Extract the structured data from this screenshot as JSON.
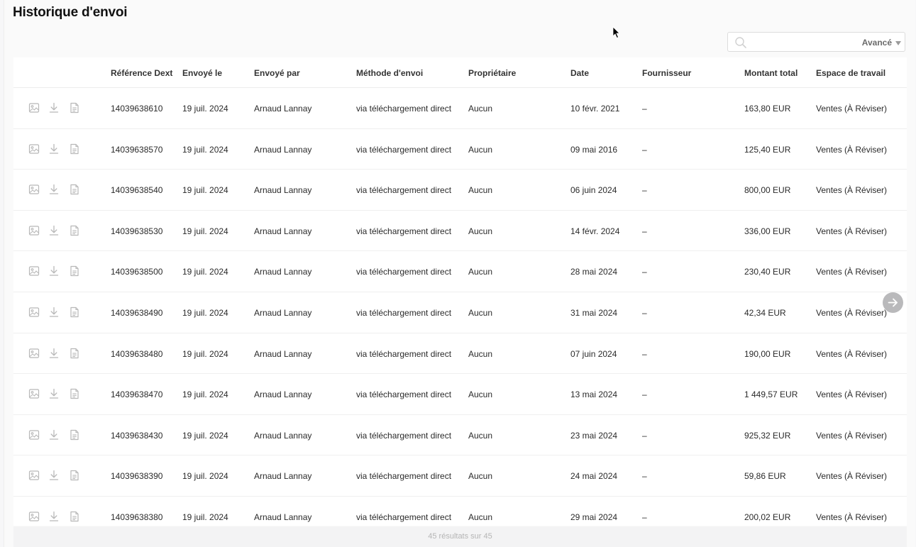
{
  "page": {
    "title": "Historique d'envoi",
    "footer_text": "45 résultats sur 45"
  },
  "search": {
    "placeholder": "",
    "value": "",
    "advanced_label": "Avancé"
  },
  "icons": {
    "row_actions": [
      "image-preview-icon",
      "download-icon",
      "document-icon"
    ],
    "next_page": "arrow-right-icon",
    "search": "search-icon"
  },
  "colors": {
    "icon_gray": "#b8b8b8",
    "header_text": "#333333",
    "next_button": "#b9b9bb"
  },
  "table": {
    "columns": [
      {
        "key": "ref",
        "label": "Référence Dext"
      },
      {
        "key": "sent_on",
        "label": "Envoyé le"
      },
      {
        "key": "sent_by",
        "label": "Envoyé par"
      },
      {
        "key": "method",
        "label": "Méthode d'envoi"
      },
      {
        "key": "owner",
        "label": "Propriétaire"
      },
      {
        "key": "date",
        "label": "Date"
      },
      {
        "key": "supplier",
        "label": "Fournisseur"
      },
      {
        "key": "total",
        "label": "Montant total"
      },
      {
        "key": "workspace",
        "label": "Espace de travail"
      }
    ],
    "rows": [
      {
        "ref": "14039638610",
        "sent_on": "19 juil. 2024",
        "sent_by": "Arnaud Lannay",
        "method": "via téléchargement direct",
        "owner": "Aucun",
        "date": "10 févr. 2021",
        "supplier": "–",
        "total": "163,80 EUR",
        "workspace": "Ventes (À Réviser)"
      },
      {
        "ref": "14039638570",
        "sent_on": "19 juil. 2024",
        "sent_by": "Arnaud Lannay",
        "method": "via téléchargement direct",
        "owner": "Aucun",
        "date": "09 mai 2016",
        "supplier": "–",
        "total": "125,40 EUR",
        "workspace": "Ventes (À Réviser)"
      },
      {
        "ref": "14039638540",
        "sent_on": "19 juil. 2024",
        "sent_by": "Arnaud Lannay",
        "method": "via téléchargement direct",
        "owner": "Aucun",
        "date": "06 juin 2024",
        "supplier": "–",
        "total": "800,00 EUR",
        "workspace": "Ventes (À Réviser)"
      },
      {
        "ref": "14039638530",
        "sent_on": "19 juil. 2024",
        "sent_by": "Arnaud Lannay",
        "method": "via téléchargement direct",
        "owner": "Aucun",
        "date": "14 févr. 2024",
        "supplier": "–",
        "total": "336,00 EUR",
        "workspace": "Ventes (À Réviser)"
      },
      {
        "ref": "14039638500",
        "sent_on": "19 juil. 2024",
        "sent_by": "Arnaud Lannay",
        "method": "via téléchargement direct",
        "owner": "Aucun",
        "date": "28 mai 2024",
        "supplier": "–",
        "total": "230,40 EUR",
        "workspace": "Ventes (À Réviser)"
      },
      {
        "ref": "14039638490",
        "sent_on": "19 juil. 2024",
        "sent_by": "Arnaud Lannay",
        "method": "via téléchargement direct",
        "owner": "Aucun",
        "date": "31 mai 2024",
        "supplier": "–",
        "total": "42,34 EUR",
        "workspace": "Ventes (À Réviser)"
      },
      {
        "ref": "14039638480",
        "sent_on": "19 juil. 2024",
        "sent_by": "Arnaud Lannay",
        "method": "via téléchargement direct",
        "owner": "Aucun",
        "date": "07 juin 2024",
        "supplier": "–",
        "total": "190,00 EUR",
        "workspace": "Ventes (À Réviser)"
      },
      {
        "ref": "14039638470",
        "sent_on": "19 juil. 2024",
        "sent_by": "Arnaud Lannay",
        "method": "via téléchargement direct",
        "owner": "Aucun",
        "date": "13 mai 2024",
        "supplier": "–",
        "total": "1 449,57 EUR",
        "workspace": "Ventes (À Réviser)"
      },
      {
        "ref": "14039638430",
        "sent_on": "19 juil. 2024",
        "sent_by": "Arnaud Lannay",
        "method": "via téléchargement direct",
        "owner": "Aucun",
        "date": "23 mai 2024",
        "supplier": "–",
        "total": "925,32 EUR",
        "workspace": "Ventes (À Réviser)"
      },
      {
        "ref": "14039638390",
        "sent_on": "19 juil. 2024",
        "sent_by": "Arnaud Lannay",
        "method": "via téléchargement direct",
        "owner": "Aucun",
        "date": "24 mai 2024",
        "supplier": "–",
        "total": "59,86 EUR",
        "workspace": "Ventes (À Réviser)"
      },
      {
        "ref": "14039638380",
        "sent_on": "19 juil. 2024",
        "sent_by": "Arnaud Lannay",
        "method": "via téléchargement direct",
        "owner": "Aucun",
        "date": "29 mai 2024",
        "supplier": "–",
        "total": "200,02 EUR",
        "workspace": "Ventes (À Réviser)"
      }
    ]
  }
}
